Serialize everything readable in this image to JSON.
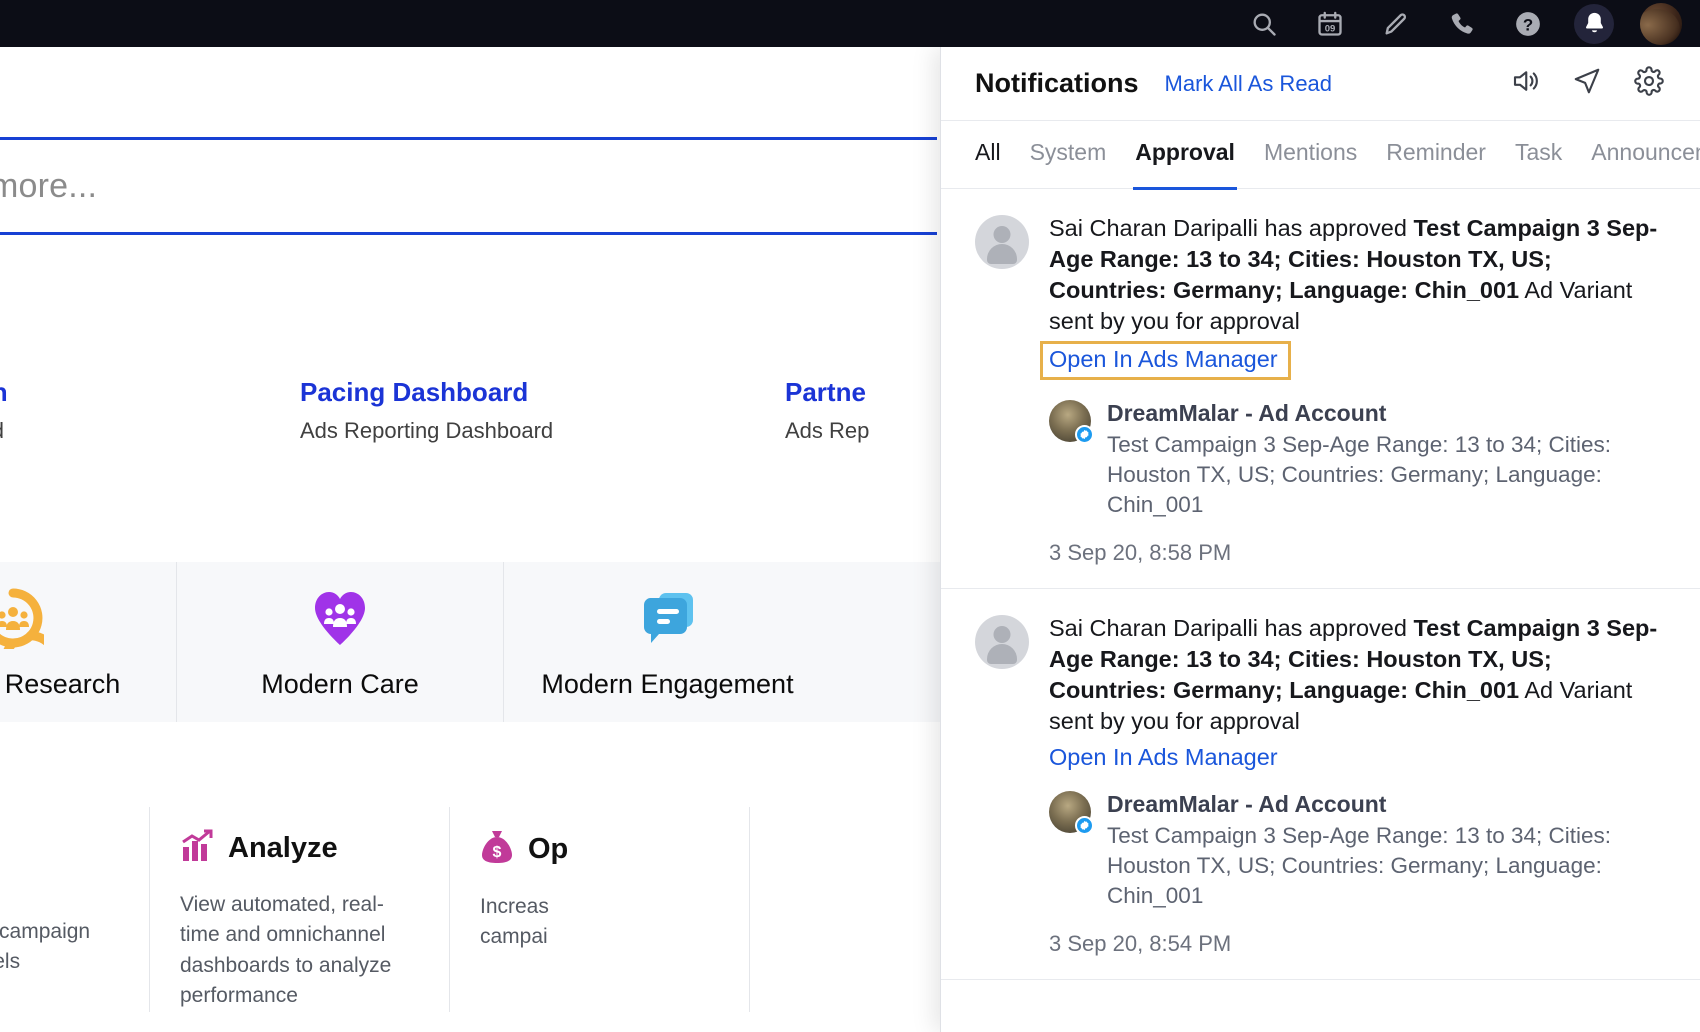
{
  "topbar": {
    "icons": [
      {
        "name": "search-icon",
        "label": "Search"
      },
      {
        "name": "calendar-icon",
        "label": "Calendar",
        "day": "09"
      },
      {
        "name": "pencil-icon",
        "label": "Compose"
      },
      {
        "name": "phone-icon",
        "label": "Call"
      },
      {
        "name": "help-icon",
        "label": "Help"
      },
      {
        "name": "bell-icon",
        "label": "Notifications",
        "active": true
      },
      {
        "name": "avatar",
        "label": "Profile"
      }
    ],
    "bg_color": "#0c0d16",
    "active_bg": "#23243a"
  },
  "background": {
    "search": {
      "placeholder": "more...",
      "border_color": "#1740d4"
    },
    "links": [
      {
        "title": "tion",
        "subtitle": "oard"
      },
      {
        "title": "Pacing Dashboard",
        "subtitle": "Ads Reporting Dashboard"
      },
      {
        "title": "Partne",
        "subtitle": "Ads Rep"
      }
    ],
    "icon_cards": [
      {
        "label": "Modern Research",
        "icon": "research-cycle-icon",
        "color": "#f5b13d"
      },
      {
        "label": "Modern Care",
        "icon": "heart-people-icon",
        "color": "#a033e8"
      },
      {
        "label": "Modern Engagement",
        "icon": "chat-bubbles-icon",
        "color": "#3da5dd"
      }
    ],
    "features": [
      {
        "title": "",
        "icon": "",
        "desc": "mlining your campaign\ncross channels",
        "color": ""
      },
      {
        "title": "Analyze",
        "icon": "bar-chart-icon",
        "desc": "View automated, real-time and omnichannel dashboards to analyze performance",
        "color": "#c13a99"
      },
      {
        "title": "Op",
        "icon": "money-bag-icon",
        "desc": "Increas\ncampai",
        "color": "#c13a99"
      }
    ]
  },
  "panel": {
    "title": "Notifications",
    "mark_all_as_read": "Mark All As Read",
    "header_icons": [
      {
        "name": "speaker-icon",
        "label": "Sound"
      },
      {
        "name": "send-icon",
        "label": "Send"
      },
      {
        "name": "gear-icon",
        "label": "Settings"
      }
    ],
    "tabs": [
      {
        "label": "All",
        "state": "dark"
      },
      {
        "label": "System",
        "state": "muted"
      },
      {
        "label": "Approval",
        "state": "selected"
      },
      {
        "label": "Mentions",
        "state": "muted"
      },
      {
        "label": "Reminder",
        "state": "muted"
      },
      {
        "label": "Task",
        "state": "muted"
      },
      {
        "label": "Announcement",
        "state": "muted"
      }
    ],
    "accent_color": "#1a56db",
    "highlight_color": "#e7b04a",
    "notifications": [
      {
        "actor": "Sai Charan Daripalli has approved ",
        "subject": "Test Campaign 3 Sep-Age Range: 13 to 34; Cities: Houston TX, US; Countries: Germany; Language: Chin_001",
        "suffix": " Ad Variant sent by you for approval",
        "link": "Open In Ads Manager",
        "highlighted": true,
        "card": {
          "name": "DreamMalar - Ad Account",
          "desc": "Test Campaign 3 Sep-Age Range: 13 to 34; Cities: Houston TX, US; Countries: Germany; Language: Chin_001",
          "verified": true
        },
        "time": "3 Sep 20, 8:58 PM"
      },
      {
        "actor": "Sai Charan Daripalli has approved ",
        "subject": "Test Campaign 3 Sep-Age Range: 13 to 34; Cities: Houston TX, US; Countries: Germany; Language: Chin_001",
        "suffix": " Ad Variant sent by you for approval",
        "link": "Open In Ads Manager",
        "highlighted": false,
        "card": {
          "name": "DreamMalar - Ad Account",
          "desc": "Test Campaign 3 Sep-Age Range: 13 to 34; Cities: Houston TX, US; Countries: Germany; Language: Chin_001",
          "verified": true
        },
        "time": "3 Sep 20, 8:54 PM"
      }
    ]
  }
}
